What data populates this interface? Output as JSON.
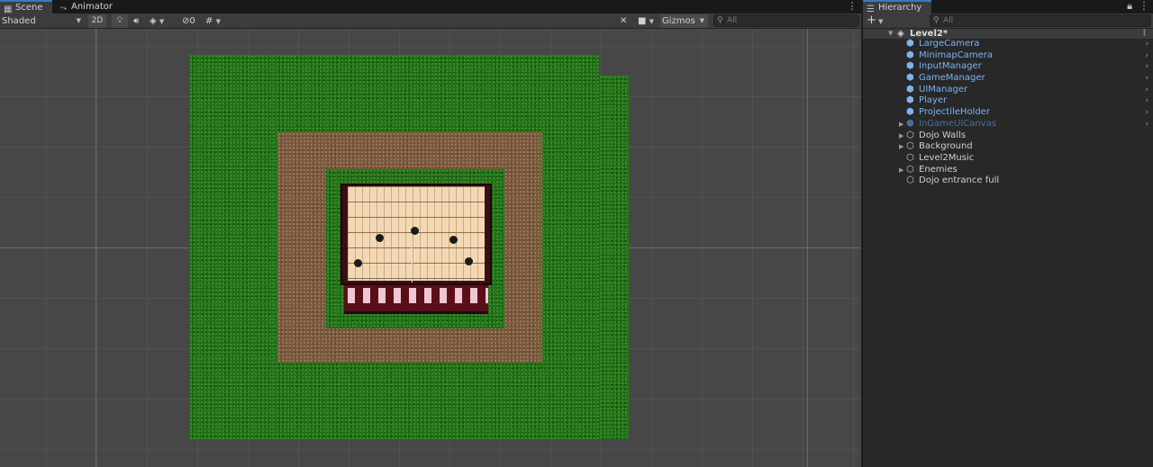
{
  "scene_window": {
    "tabs": [
      {
        "label": "Scene",
        "icon": "grid-icon",
        "active": true
      },
      {
        "label": "Animator",
        "icon": "animator-icon",
        "active": false
      }
    ],
    "toolbar": {
      "shading_mode": "Shaded",
      "mode_2d_label": "2D",
      "hidden_count": "0",
      "gizmos_label": "Gizmos",
      "search_placeholder": "All"
    }
  },
  "hierarchy_window": {
    "tab_label": "Hierarchy",
    "add_label": "+",
    "search_placeholder": "All",
    "scene": {
      "name": "Level2*"
    },
    "items": [
      {
        "name": "LargeCamera",
        "type": "prefab",
        "expandable": false
      },
      {
        "name": "MinimapCamera",
        "type": "prefab",
        "expandable": false
      },
      {
        "name": "InputManager",
        "type": "prefab",
        "expandable": false
      },
      {
        "name": "GameManager",
        "type": "prefab",
        "expandable": false
      },
      {
        "name": "UIManager",
        "type": "prefab",
        "expandable": false
      },
      {
        "name": "Player",
        "type": "prefab",
        "expandable": false
      },
      {
        "name": "ProjectileHolder",
        "type": "prefab",
        "expandable": false
      },
      {
        "name": "InGameUICanvas",
        "type": "prefab-disabled",
        "expandable": true
      },
      {
        "name": "Dojo Walls",
        "type": "object",
        "expandable": true
      },
      {
        "name": "Background",
        "type": "object",
        "expandable": true
      },
      {
        "name": "Level2Music",
        "type": "object",
        "expandable": false
      },
      {
        "name": "Enemies",
        "type": "object",
        "expandable": true
      },
      {
        "name": "Dojo entrance full",
        "type": "object",
        "expandable": false
      }
    ]
  },
  "colors": {
    "accent": "#3a79bb",
    "prefab_text": "#7cb3f3",
    "grass": "#1f6b16",
    "dirt": "#7a5a3e",
    "wall": "#3a0f14"
  }
}
